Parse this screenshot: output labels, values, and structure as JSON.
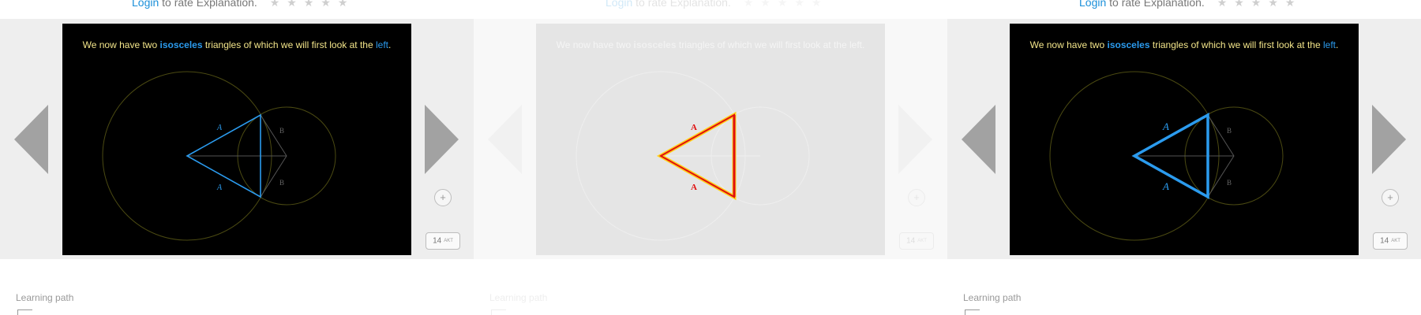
{
  "rating": {
    "login_link": "Login",
    "prompt_text": "to rate Explanation.",
    "stars": "★★★★★"
  },
  "slide": {
    "caption_pre": "We now have two",
    "caption_hl1": "isosceles",
    "caption_mid": "triangles of which we will first look at the",
    "caption_hl2": "left",
    "caption_end": ".",
    "label_a": "A",
    "label_b": "B"
  },
  "nav": {
    "zoom_symbol": "+",
    "slide_number": "14",
    "slide_total_label": "AKT"
  },
  "learning_path": {
    "label": "Learning path"
  },
  "colors": {
    "accent_blue": "#2b9bee",
    "caption_yellow": "#f3e58a",
    "circle_olive": "#4b4a12",
    "highlight_red": "#e01010",
    "highlight_yellow": "#ffd21a"
  }
}
